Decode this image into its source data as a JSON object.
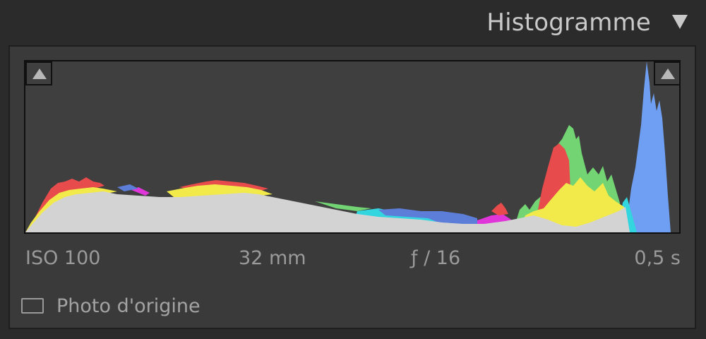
{
  "panel": {
    "title": "Histogramme",
    "collapse_icon": "triangle-down-icon"
  },
  "histogram": {
    "shadow_clipping_icon": "triangle-up-icon",
    "highlight_clipping_icon": "triangle-up-icon",
    "colors": {
      "background": "#3f3f3f",
      "luminance": "#d3d3d3",
      "red": "#e84b4b",
      "green": "#72d472",
      "blue": "#6f9ff2",
      "yellow": "#f2ea4a",
      "cyan": "#33d6df",
      "magenta": "#e035d8"
    }
  },
  "exif": {
    "iso": "ISO 100",
    "focal_length": "32 mm",
    "aperture": "ƒ / 16",
    "shutter": "0,5 s"
  },
  "original_photo": {
    "checked": false,
    "label": "Photo d'origine"
  }
}
